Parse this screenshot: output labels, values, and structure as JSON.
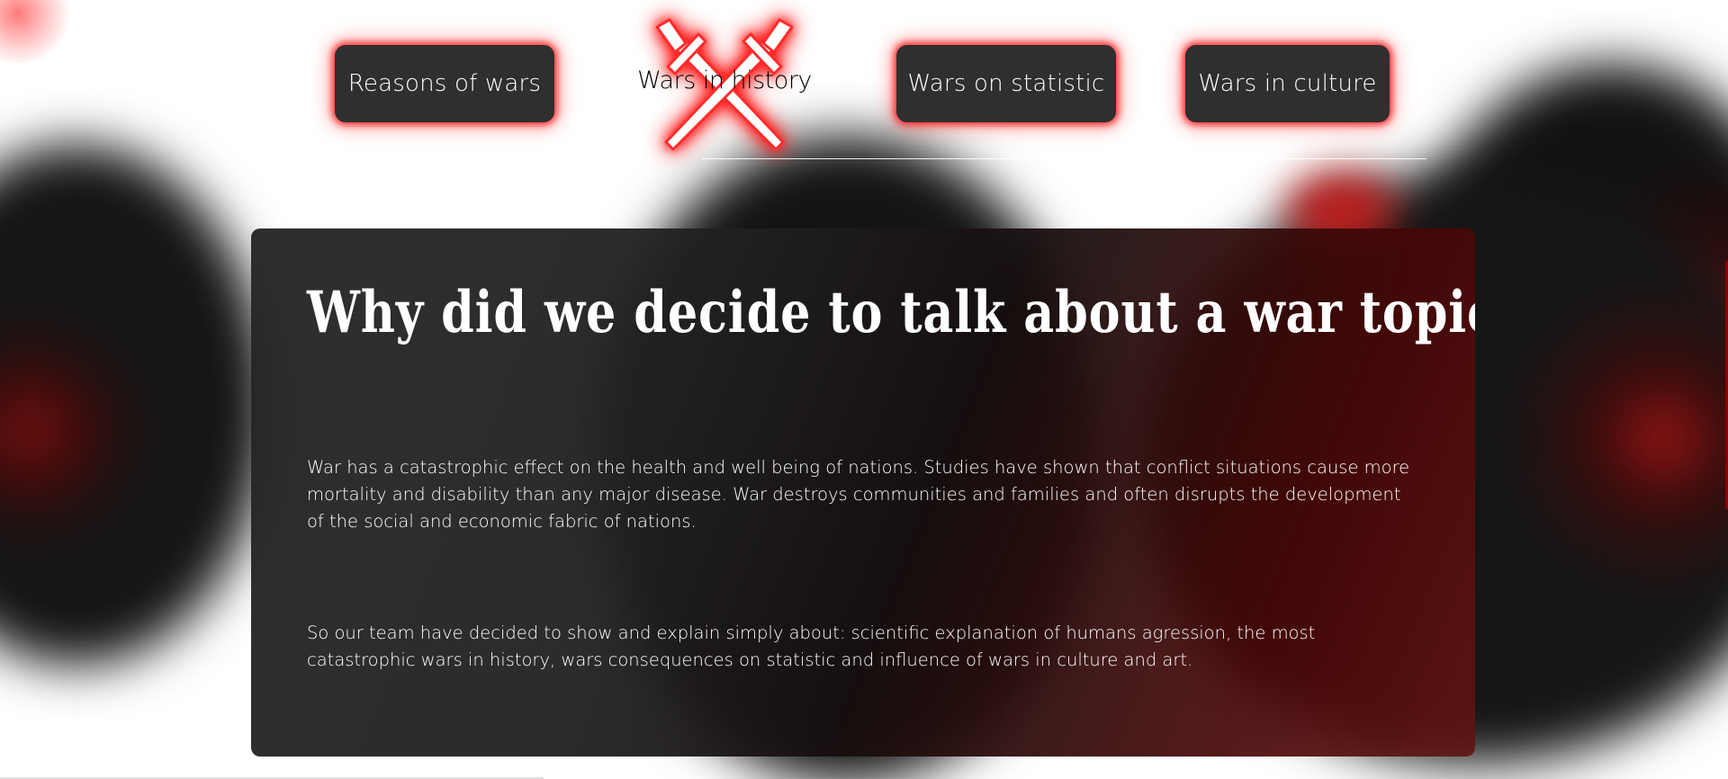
{
  "nav": {
    "items": [
      {
        "label": "Reasons of wars"
      },
      {
        "label": "Wars in history"
      },
      {
        "label": "Wars on statistic"
      },
      {
        "label": "Wars in culture"
      }
    ],
    "logo_icon": "crossed-swords-icon"
  },
  "main": {
    "title": "Why did we decide to talk about a war topic?",
    "paragraphs": [
      "War has a catastrophic effect on the health and well being of nations. Studies have shown that conflict situations cause more mortality and disability than any major disease. War destroys communities and families and often disrupts the development of the social and economic fabric of nations.",
      "So our team have decided to show and explain simply about: scientific explanation of humans agression, the most catastrophic wars in history, wars consequences on statistic and influence of wars in culture and art."
    ]
  },
  "colors": {
    "accent_glow": "#ff0000",
    "button_bg": "#2f2f2f",
    "panel_dark": "#262626",
    "panel_red": "#600a0a"
  }
}
